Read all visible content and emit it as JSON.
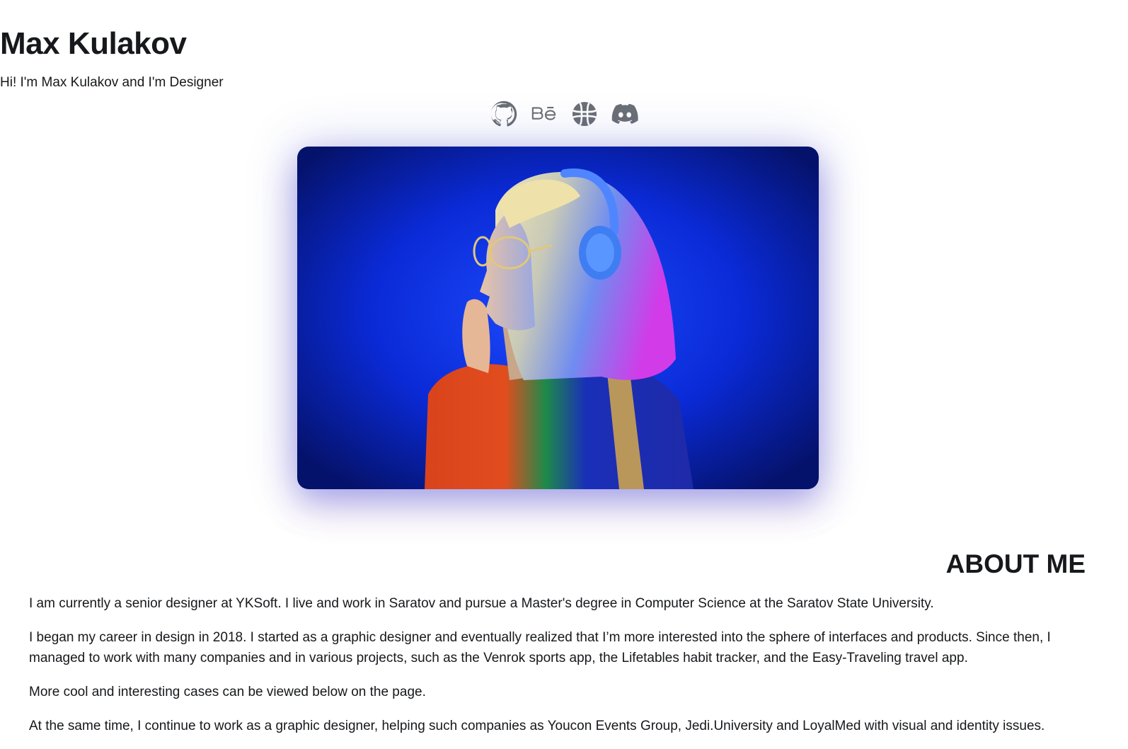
{
  "header": {
    "name": "Max Kulakov",
    "tagline": "Hi! I'm Max Kulakov and I'm Designer"
  },
  "socials": [
    {
      "icon": "github-icon",
      "label": "GitHub"
    },
    {
      "icon": "behance-icon",
      "label": "Behance"
    },
    {
      "icon": "dribbble-icon",
      "label": "Dribbble"
    },
    {
      "icon": "discord-icon",
      "label": "Discord"
    }
  ],
  "hero_image": {
    "alt": "Portrait of a woman with blonde bob hair, glasses and headphones against a blue background"
  },
  "about": {
    "title": "ABOUT ME",
    "paragraphs": [
      "I am currently a senior designer at YKSoft. I live and work in Saratov and pursue a Master's degree in Computer Science at the Saratov State University.",
      "I began my career in design in 2018. I started as a graphic designer and eventually realized that I’m more interested into the sphere of interfaces and products. Since then, I managed to work with many companies and in various projects, such as the Venrok sports app, the Lifetables habit tracker, and the Easy-Traveling travel app.",
      "More cool and interesting cases can be viewed below on the page.",
      "At the same time, I continue to work as a graphic designer, helping such companies as Youcon Events Group, Jedi.University and LoyalMed with visual and identity issues."
    ]
  },
  "colors": {
    "text": "#16181b",
    "icon": "#6b6f76",
    "photo_background": "#0a2ee0",
    "shadow_glow": "#3746e6"
  }
}
